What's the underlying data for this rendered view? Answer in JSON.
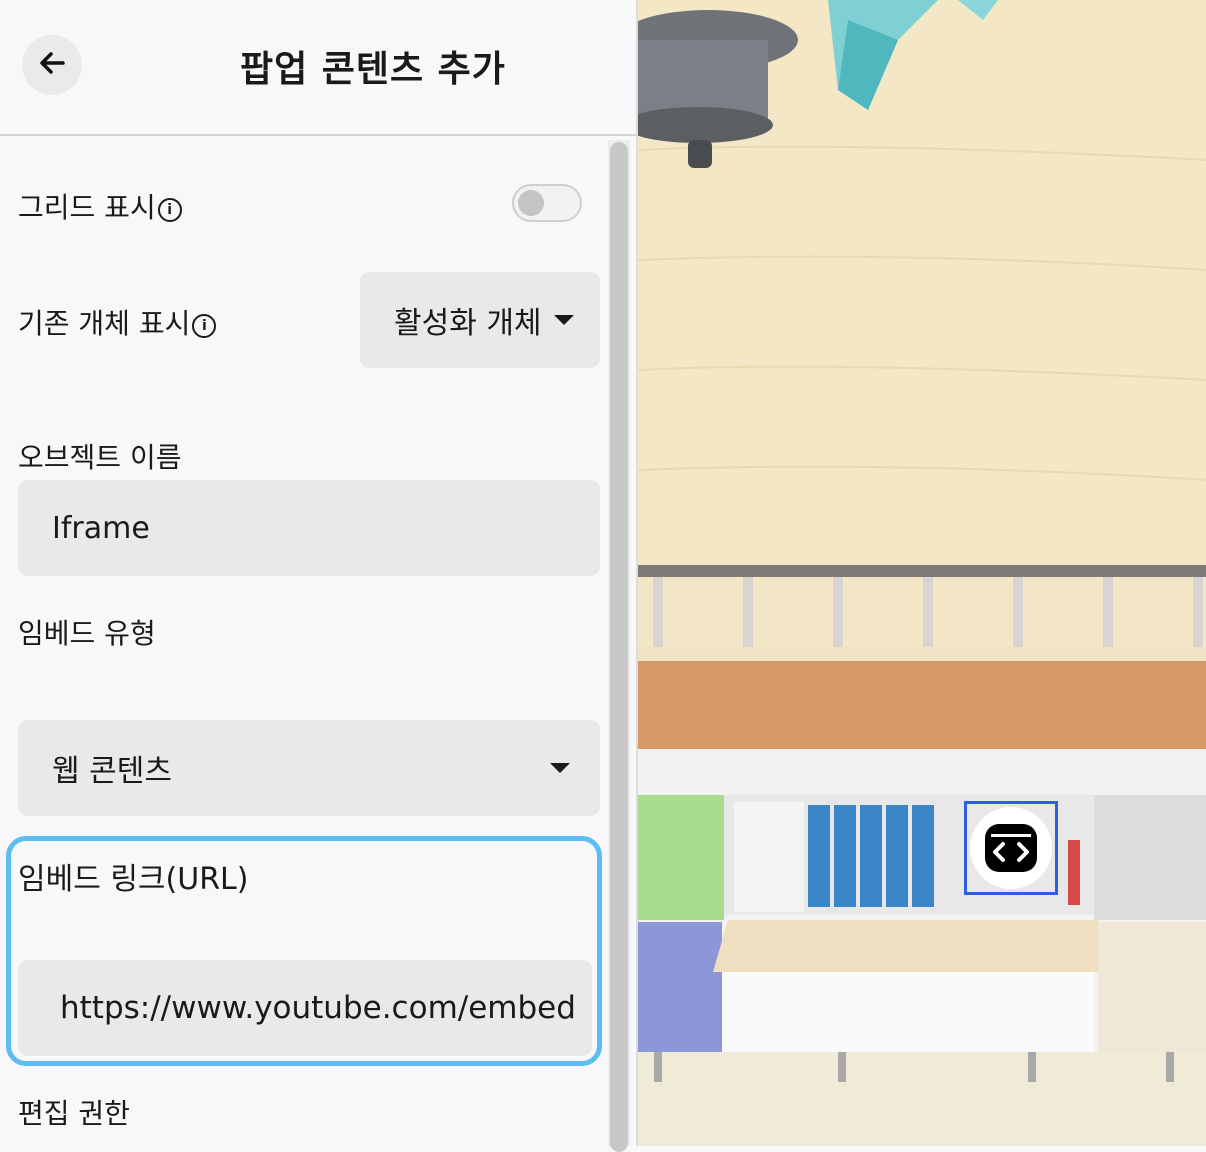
{
  "header": {
    "title": "팝업 콘텐츠 추가",
    "back_icon": "arrow-left-icon"
  },
  "grid": {
    "label": "그리드 표시",
    "info_icon": "info-icon",
    "enabled": false
  },
  "existing_objects": {
    "label": "기존 개체 표시",
    "info_icon": "info-icon",
    "selected": "활성화 개체"
  },
  "object_name": {
    "label": "오브젝트 이름",
    "value": "Iframe"
  },
  "embed_type": {
    "label": "임베드 유형",
    "selected": "웹 콘텐츠"
  },
  "embed_link": {
    "label": "임베드 링크(URL)",
    "value": "https://www.youtube.com/embed"
  },
  "edit_permission": {
    "label": "편집 권한"
  },
  "scene": {
    "selected_object_icon": "code-embed-icon",
    "selection_color": "#2f5fe0"
  },
  "colors": {
    "focus_border": "#5bbdf0",
    "panel_bg": "#f8f8fa",
    "field_bg": "#e9e9eb"
  }
}
